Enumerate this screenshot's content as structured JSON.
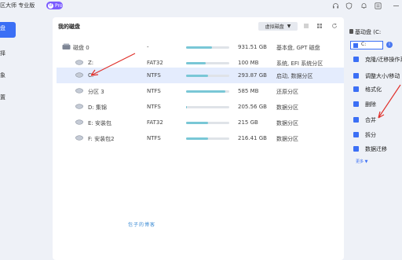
{
  "window": {
    "title": "区大师 专业版",
    "pro_badge": "Pro",
    "pro_badge_u": "U",
    "icons": [
      "headset-icon",
      "shield-icon",
      "bell-icon",
      "menu-icon",
      "minimize-icon"
    ]
  },
  "sidebar": {
    "items": [
      {
        "label": "盘"
      },
      {
        "label": "择"
      },
      {
        "label": "象"
      },
      {
        "label": "置"
      }
    ]
  },
  "main": {
    "title": "我的磁盘",
    "vdisk_label": "虚拟磁盘",
    "vdisk_caret": "▼",
    "rows": [
      {
        "type": "disk",
        "name": "磁盘 0",
        "fs": "-",
        "used": 0.6,
        "size": "931.51 GB",
        "info": "基本盘, GPT 磁盘"
      },
      {
        "type": "part",
        "name": "Z:",
        "fs": "FAT32",
        "used": 0.45,
        "size": "100 MB",
        "info": "系统, EFI 系统分区"
      },
      {
        "type": "part",
        "name": "C:",
        "fs": "NTFS",
        "used": 0.5,
        "size": "293.87 GB",
        "info": "启动, 数据分区",
        "selected": true
      },
      {
        "type": "part",
        "name": "分区 3",
        "fs": "NTFS",
        "used": 0.9,
        "size": "585 MB",
        "info": "还原分区"
      },
      {
        "type": "part",
        "name": "D: 集锦",
        "fs": "NTFS",
        "used": 0.02,
        "size": "205.56 GB",
        "info": "数据分区"
      },
      {
        "type": "part",
        "name": "E: 安装包",
        "fs": "FAT32",
        "used": 0.5,
        "size": "215 GB",
        "info": "数据分区"
      },
      {
        "type": "part",
        "name": "F: 安装包2",
        "fs": "NTFS",
        "used": 0.5,
        "size": "216.41 GB",
        "info": "数据分区"
      }
    ],
    "watermark": "包子的博客"
  },
  "right_panel": {
    "header": "基动盘 (C:",
    "drive_label": "C:",
    "info_icon": "i",
    "actions": [
      {
        "label": "克隆/迁移操作系"
      },
      {
        "label": "调整大小/移动"
      },
      {
        "label": "格式化"
      },
      {
        "label": "删除"
      },
      {
        "label": "合并"
      },
      {
        "label": "拆分"
      },
      {
        "label": "数据迁移"
      }
    ],
    "more_label": "更多 ▼"
  },
  "colors": {
    "accent": "#3b6ff5",
    "pro_badge": "#7b5cff",
    "selected_row": "#e4ecfd",
    "usage_bar": "#79c7d6",
    "arrow": "#e0302a"
  }
}
